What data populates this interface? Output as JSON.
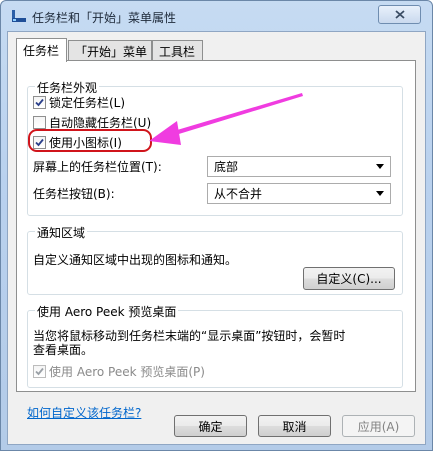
{
  "window": {
    "title": "任务栏和「开始」菜单属性"
  },
  "tabs": [
    {
      "label": "任务栏"
    },
    {
      "label": "「开始」菜单"
    },
    {
      "label": "工具栏"
    }
  ],
  "appearance": {
    "group_title": "任务栏外观",
    "lock_taskbar": {
      "label": "锁定任务栏(L)",
      "checked": true
    },
    "auto_hide": {
      "label": "自动隐藏任务栏(U)",
      "checked": false
    },
    "small_icons": {
      "label": "使用小图标(I)",
      "checked": true
    },
    "position_label": "屏幕上的任务栏位置(T):",
    "position_value": "底部",
    "buttons_label": "任务栏按钮(B):",
    "buttons_value": "从不合并"
  },
  "notification": {
    "group_title": "通知区域",
    "description": "自定义通知区域中出现的图标和通知。",
    "customize_button": "自定义(C)..."
  },
  "aero_peek": {
    "group_title": "使用 Aero Peek 预览桌面",
    "description_line1": "当您将鼠标移动到任务栏末端的“显示桌面”按钮时，会暂时",
    "description_line2": "查看桌面。",
    "use_peek": {
      "label": "使用 Aero Peek 预览桌面(P)",
      "checked": true,
      "disabled": true
    }
  },
  "help_link": "如何自定义该任务栏?",
  "footer": {
    "ok": "确定",
    "cancel": "取消",
    "apply": "应用(A)"
  },
  "colors": {
    "annotation_red": "#d0141b",
    "annotation_arrow": "#f03ce0",
    "link_blue": "#0066cc"
  }
}
